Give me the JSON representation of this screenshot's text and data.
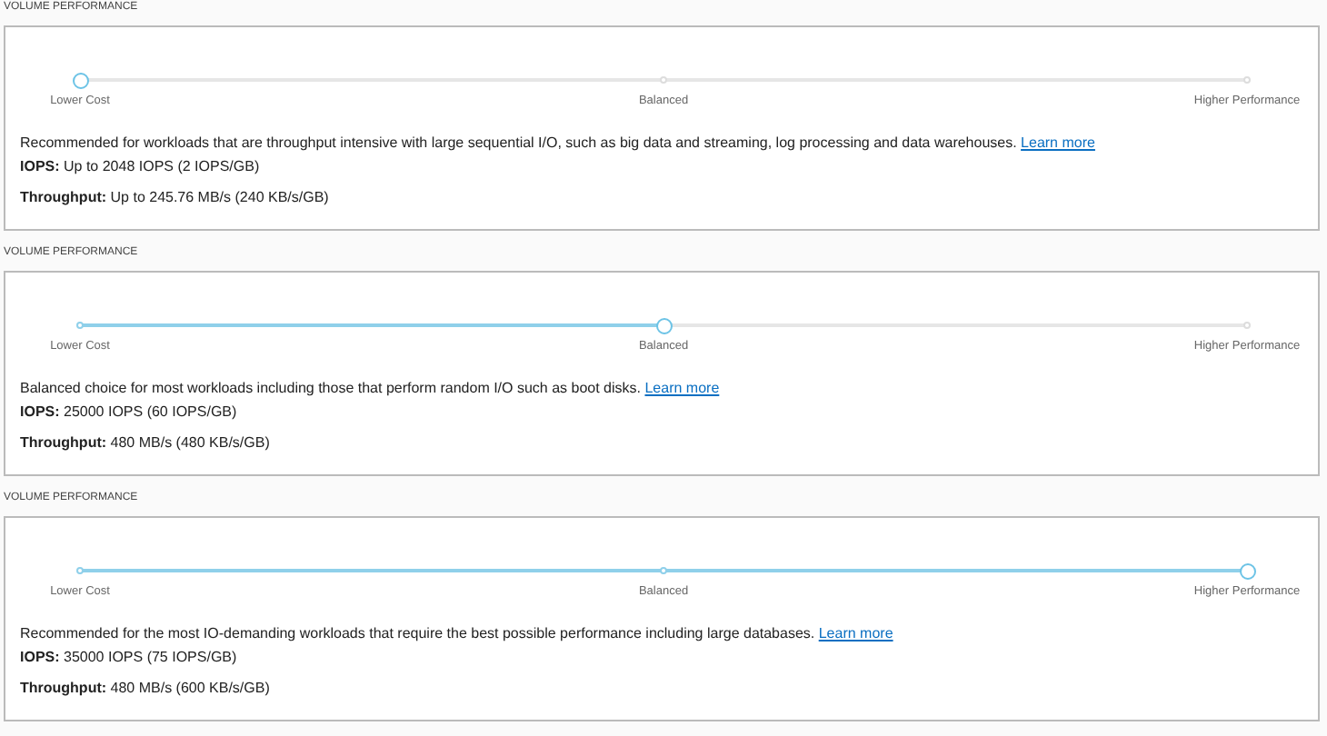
{
  "panels": [
    {
      "heading": "VOLUME PERFORMANCE",
      "slider": {
        "level": 0,
        "stops": [
          {
            "label": "Lower Cost",
            "selected": true
          },
          {
            "label": "Balanced",
            "selected": false
          },
          {
            "label": "Higher Performance",
            "selected": false
          }
        ]
      },
      "description": "Recommended for workloads that are throughput intensive with large sequential I/O, such as big data and streaming, log processing and data warehouses.",
      "link": "Learn more",
      "iops": "**IOPS:** Up to 2048 IOPS (2 IOPS/GB)",
      "throughput": "**Throughput:** Up to 245.76 MB/s (240 KB/s/GB)"
    },
    {
      "heading": "VOLUME PERFORMANCE",
      "slider": {
        "level": 0.5,
        "stops": [
          {
            "label": "Lower Cost",
            "selected": false
          },
          {
            "label": "Balanced",
            "selected": true
          },
          {
            "label": "Higher Performance",
            "selected": false
          }
        ]
      },
      "description": "Balanced choice for most workloads including those that perform random I/O such as boot disks.",
      "link": "Learn more",
      "iops": "**IOPS:** 25000 IOPS (60 IOPS/GB)",
      "throughput": "**Throughput:** 480 MB/s (480 KB/s/GB)"
    },
    {
      "heading": "VOLUME PERFORMANCE",
      "slider": {
        "level": 1,
        "stops": [
          {
            "label": "Lower Cost",
            "selected": false
          },
          {
            "label": "Balanced",
            "selected": false
          },
          {
            "label": "Higher Performance",
            "selected": true
          }
        ]
      },
      "description": "Recommended for the most IO-demanding workloads that require the best possible performance including large databases.",
      "link": "Learn more",
      "iops": "**IOPS:** 35000 IOPS (75 IOPS/GB)",
      "throughput": "**Throughput:** 480 MB/s (600 KB/s/GB)"
    }
  ]
}
